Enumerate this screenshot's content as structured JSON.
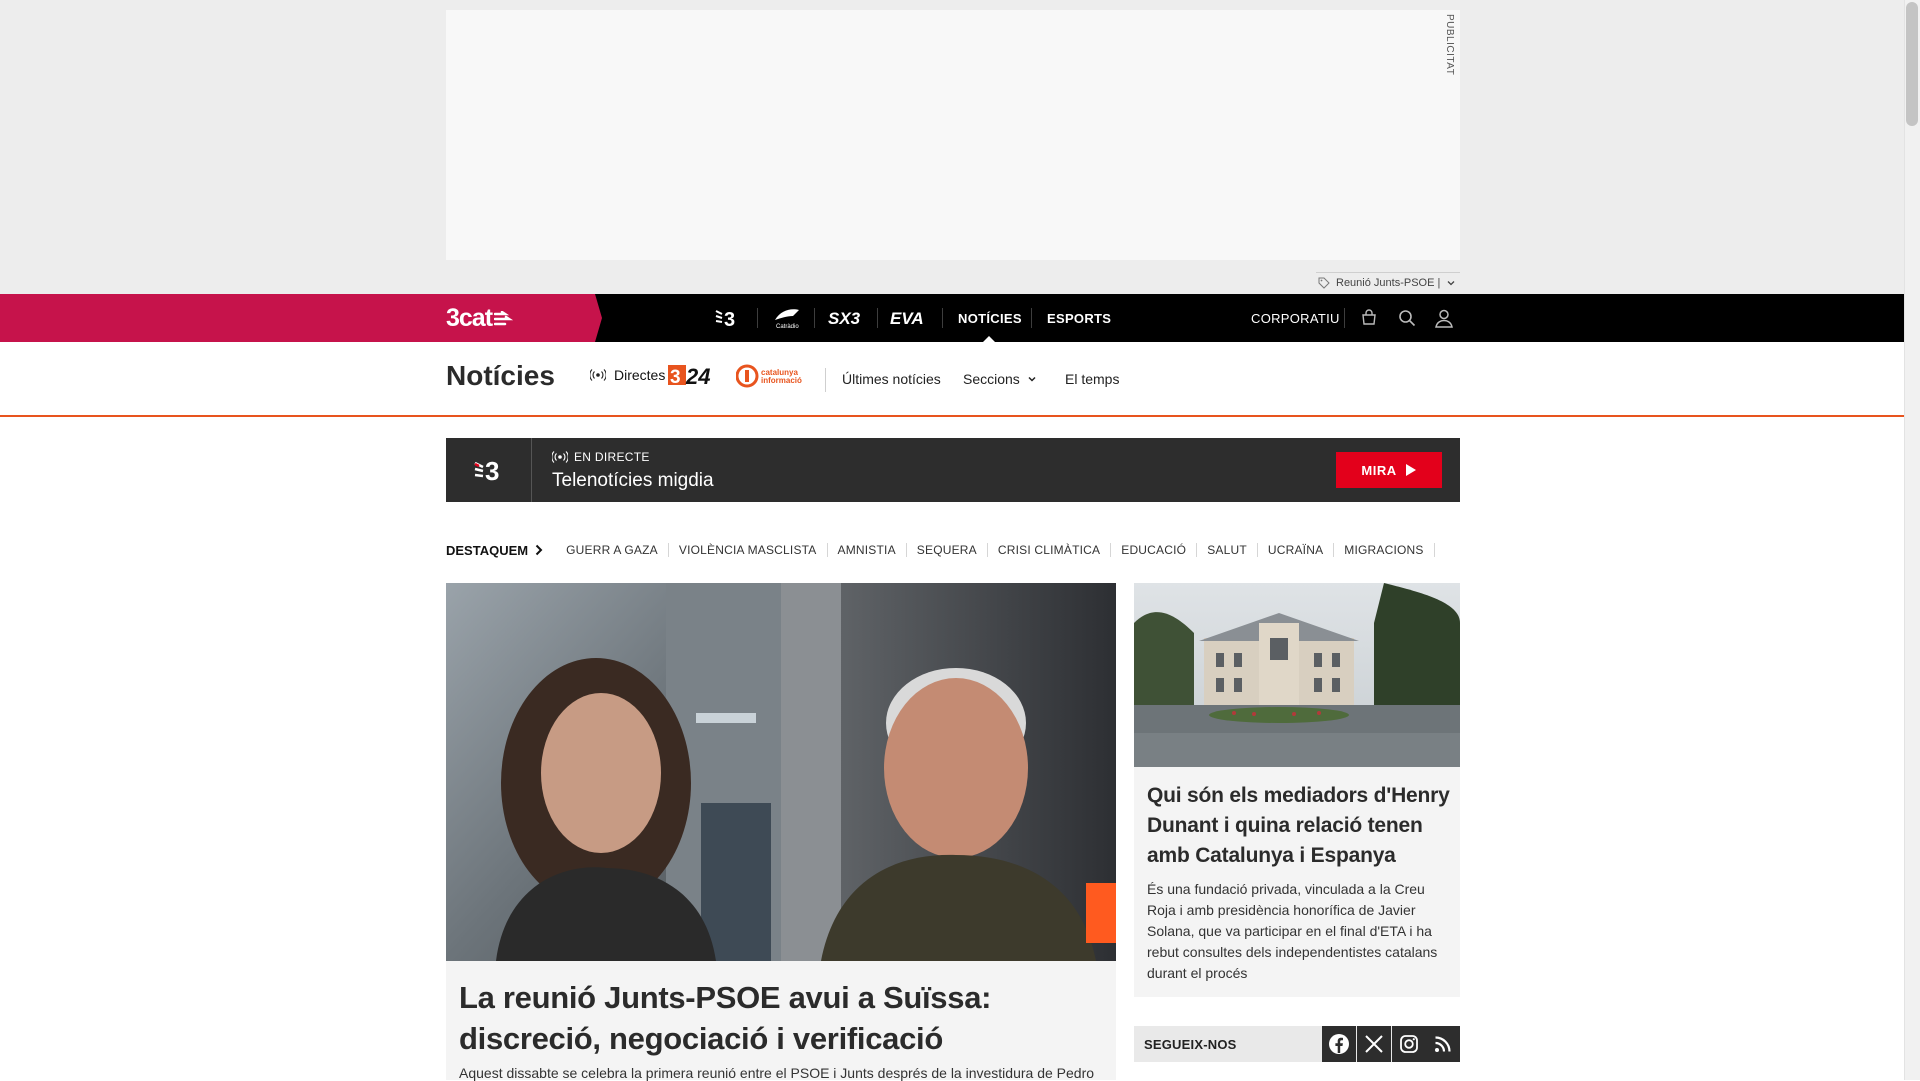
{
  "ad": {
    "label": "PUBLICITAT",
    "tag_text": "Reunió Junts-PSOE |"
  },
  "topnav": {
    "brand": "3cat",
    "channels": [
      "tv3-logo",
      "catradio-logo",
      "sx3-logo",
      "eva-logo"
    ],
    "items": [
      "NOTÍCIES",
      "ESPORTS"
    ],
    "corporatiu": "CORPORATIU",
    "active": "NOTÍCIES"
  },
  "section": {
    "title": "Notícies",
    "directes": "Directes",
    "links": {
      "ultimes": "Últimes notícies",
      "seccions": "Seccions",
      "temps": "El temps"
    }
  },
  "live": {
    "status": "EN DIRECTE",
    "title": "Telenotícies migdia",
    "button": "MIRA"
  },
  "tags": {
    "heading": "DESTAQUEM",
    "items": [
      "GUERR A GAZA",
      "VIOLÈNCIA MASCLISTA",
      "AMNISTIA",
      "SEQUERA",
      "CRISI CLIMÀTICA",
      "EDUCACIÓ",
      "SALUT",
      "UCRAÏNA",
      "MIGRACIONS"
    ]
  },
  "main_article": {
    "title": "La reunió Junts-PSOE avui a Suïssa: discreció, negociació i verificació",
    "summary": "Aquest dissabte se celebra la primera reunió entre el PSOE i Junts després de la investidura de Pedro"
  },
  "side_article": {
    "title": "Qui són els mediadors d'Henry Dunant i quina relació tenen amb Catalunya i Espanya",
    "summary": "És una fundació privada, vinculada a la Creu Roja i amb presidència honorífica de Javier Solana, que va participar en el final d'ETA i ha rebut consultes dels independentistes catalans durant el procés"
  },
  "follow": {
    "label": "SEGUEIX-NOS",
    "icons": [
      "facebook-icon",
      "x-icon",
      "instagram-icon",
      "rss-icon"
    ]
  },
  "colors": {
    "brand_red": "#c6134b",
    "section_orange": "#e8541e",
    "live_red": "#e3001b",
    "dark": "#2d2d2d"
  }
}
